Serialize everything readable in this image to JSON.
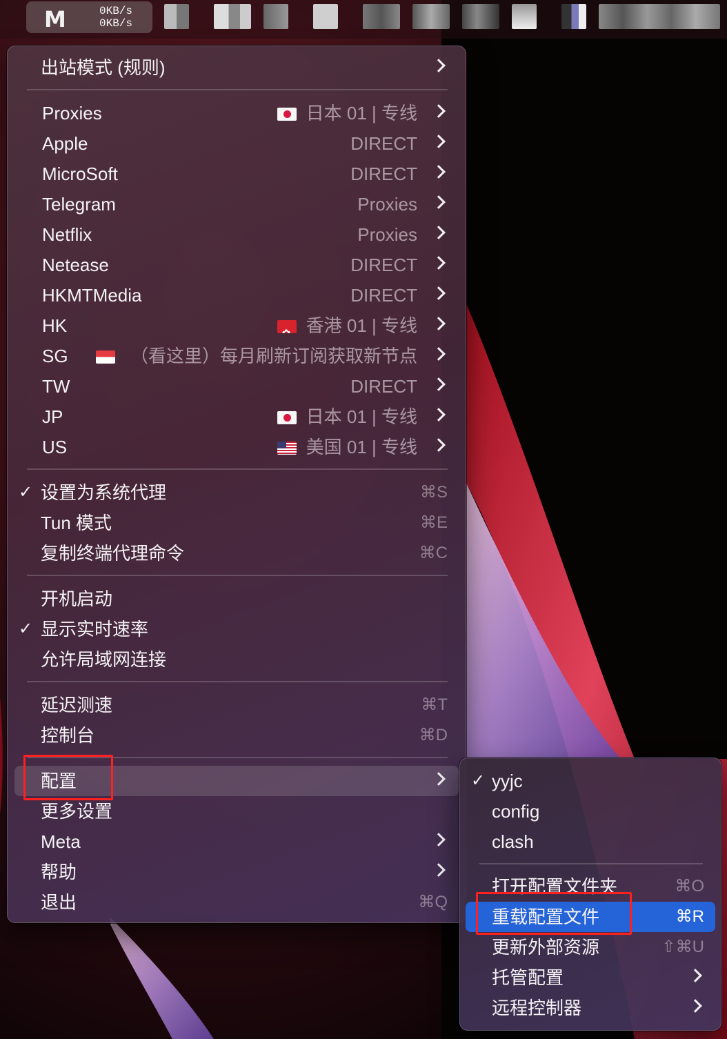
{
  "menubar": {
    "app_logo": "M",
    "upload_speed": "0KB/s",
    "download_speed": "0KB/s"
  },
  "main_menu": {
    "mode": {
      "label": "出站模式 (规则)"
    },
    "proxy_groups": [
      {
        "label": "Proxies",
        "value": "日本 01 | 专线",
        "flag": "jp"
      },
      {
        "label": "Apple",
        "value": "DIRECT",
        "flag": ""
      },
      {
        "label": "MicroSoft",
        "value": "DIRECT",
        "flag": ""
      },
      {
        "label": "Telegram",
        "value": "Proxies",
        "flag": ""
      },
      {
        "label": "Netflix",
        "value": "Proxies",
        "flag": ""
      },
      {
        "label": "Netease",
        "value": "DIRECT",
        "flag": ""
      },
      {
        "label": "HKMTMedia",
        "value": "DIRECT",
        "flag": ""
      },
      {
        "label": "HK",
        "value": "香港 01 | 专线",
        "flag": "hk"
      },
      {
        "label": "SG",
        "value": "（看这里）每月刷新订阅获取新节点",
        "flag": "sg"
      },
      {
        "label": "TW",
        "value": "DIRECT",
        "flag": ""
      },
      {
        "label": "JP",
        "value": "日本 01 | 专线",
        "flag": "jp"
      },
      {
        "label": "US",
        "value": "美国 01 | 专线",
        "flag": "us"
      }
    ],
    "proxy_settings": [
      {
        "label": "设置为系统代理",
        "shortcut": "⌘S",
        "checked": true
      },
      {
        "label": "Tun 模式",
        "shortcut": "⌘E",
        "checked": false
      },
      {
        "label": "复制终端代理命令",
        "shortcut": "⌘C",
        "checked": false
      }
    ],
    "general": [
      {
        "label": "开机启动",
        "checked": false
      },
      {
        "label": "显示实时速率",
        "checked": true
      },
      {
        "label": "允许局域网连接",
        "checked": false
      }
    ],
    "tools": [
      {
        "label": "延迟测速",
        "shortcut": "⌘T"
      },
      {
        "label": "控制台",
        "shortcut": "⌘D"
      }
    ],
    "bottom": [
      {
        "label": "配置",
        "shortcut": "",
        "submenu": true
      },
      {
        "label": "更多设置",
        "shortcut": "",
        "submenu": false
      },
      {
        "label": "Meta",
        "shortcut": "",
        "submenu": true
      },
      {
        "label": "帮助",
        "shortcut": "",
        "submenu": true
      },
      {
        "label": "退出",
        "shortcut": "⌘Q",
        "submenu": false
      }
    ]
  },
  "config_submenu": {
    "profiles": [
      {
        "label": "yyjc",
        "checked": true
      },
      {
        "label": "config",
        "checked": false
      },
      {
        "label": "clash",
        "checked": false
      }
    ],
    "actions": [
      {
        "label": "打开配置文件夹",
        "shortcut": "⌘O",
        "submenu": false
      },
      {
        "label": "重载配置文件",
        "shortcut": "⌘R",
        "submenu": false,
        "selected": true
      },
      {
        "label": "更新外部资源",
        "shortcut": "⇧⌘U",
        "submenu": false
      },
      {
        "label": "托管配置",
        "shortcut": "",
        "submenu": true
      },
      {
        "label": "远程控制器",
        "shortcut": "",
        "submenu": true
      }
    ]
  },
  "colors": {
    "selection_blue": "#2563d9",
    "annotation_red": "#ff2020"
  }
}
